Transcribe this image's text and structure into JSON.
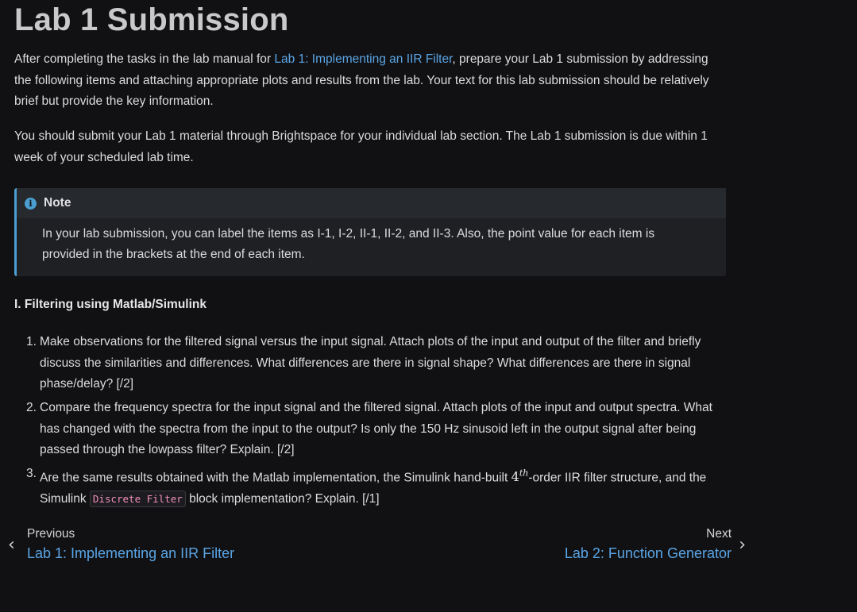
{
  "title": "Lab 1 Submission",
  "intro": {
    "before_link": "After completing the tasks in the lab manual for ",
    "link_text": "Lab 1: Implementing an IIR Filter",
    "after_link": ", prepare your Lab 1 submission by addressing the following items and attaching appropriate plots and results from the lab. Your text for this lab submission should be relatively brief but provide the key information."
  },
  "submission_para": "You should submit your Lab 1 material through Brightspace for your individual lab section. The Lab 1 submission is due within 1 week of your scheduled lab time.",
  "note": {
    "icon": "info-icon",
    "icon_glyph": "i",
    "title": "Note",
    "body": "In your lab submission, you can label the items as I-1, I-2, II-1, II-2, and II-3. Also, the point value for each item is provided in the brackets at the end of each item."
  },
  "section": {
    "heading": "I. Filtering using Matlab/Simulink",
    "items": [
      {
        "number": "1.",
        "text": "Make observations for the filtered signal versus the input signal. Attach plots of the input and output of the filter and briefly discuss the similarities and differences. What differences are there in signal shape? What differences are there in signal phase/delay? [/2]"
      },
      {
        "number": "2.",
        "text": "Compare the frequency spectra for the input signal and the filtered signal. Attach plots of the input and output spectra. What has changed with the spectra from the input to the output? Is only the 150 Hz sinusoid left in the output signal after being passed through the lowpass filter? Explain. [/2]"
      },
      {
        "number": "3.",
        "text_a": "Are the same results obtained with the Matlab implementation, the Simulink hand-built ",
        "math_base": "4",
        "math_sup": "th",
        "text_b": "-order IIR filter structure, and the Simulink ",
        "code": "Discrete Filter",
        "text_c": " block implementation? Explain. [/1]"
      }
    ]
  },
  "nav": {
    "prev_label": "Previous",
    "prev_title": "Lab 1: Implementing an IIR Filter",
    "next_label": "Next",
    "next_title": "Lab 2: Function Generator",
    "prev_icon": "chevron-left-icon",
    "next_icon": "chevron-right-icon"
  },
  "colors": {
    "background": "#111113",
    "link": "#5aa5e6",
    "note_accent": "#4a9fd1",
    "code_text": "#f28fb8"
  }
}
